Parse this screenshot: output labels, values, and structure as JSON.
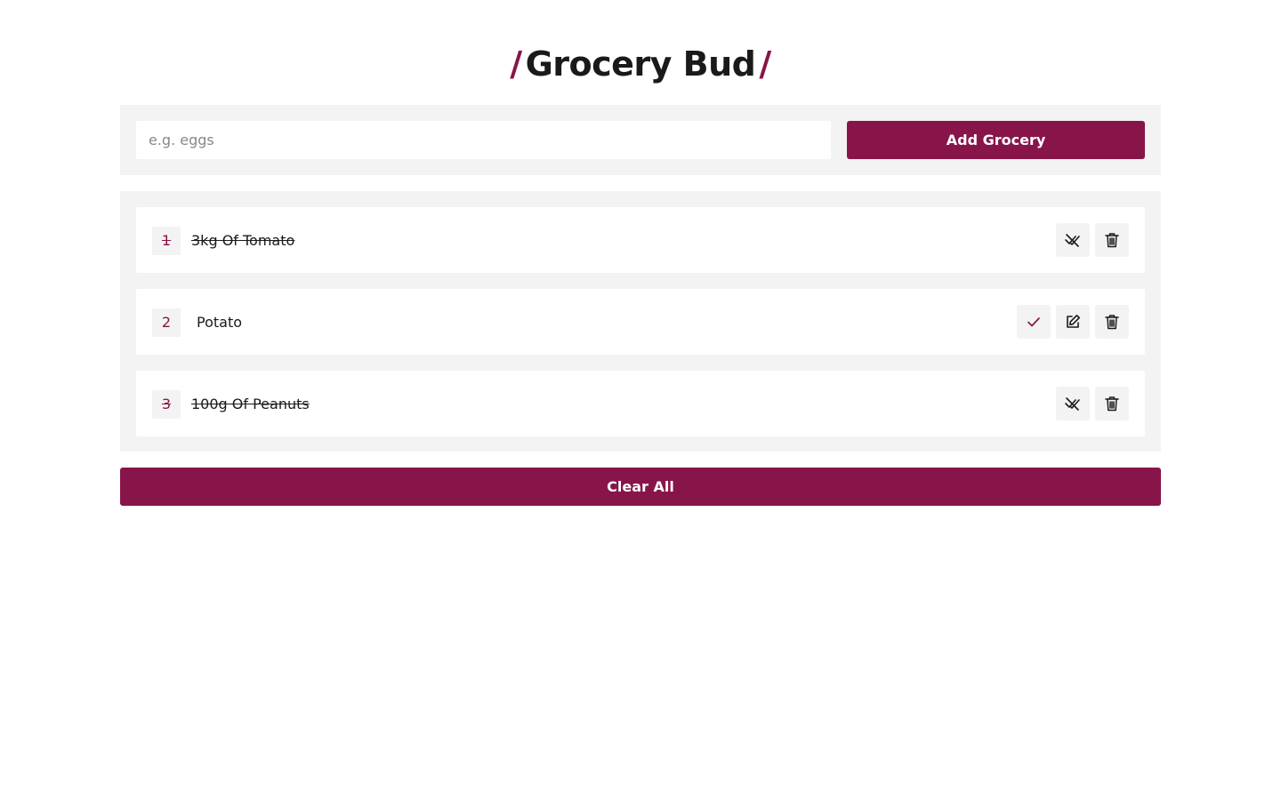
{
  "header": {
    "slash_left": "/",
    "title": "Grocery Bud",
    "slash_right": "/"
  },
  "form": {
    "placeholder": "e.g. eggs",
    "value": "",
    "add_label": "Add Grocery"
  },
  "items": [
    {
      "number": "1",
      "name": "3kg Of Tomato",
      "completed": true,
      "actions": [
        "undo-done-icon",
        "trash-icon"
      ]
    },
    {
      "number": "2",
      "name": "Potato",
      "completed": false,
      "actions": [
        "check-icon",
        "edit-icon",
        "trash-icon"
      ]
    },
    {
      "number": "3",
      "name": "100g Of Peanuts",
      "completed": true,
      "actions": [
        "undo-done-icon",
        "trash-icon"
      ]
    }
  ],
  "clear_label": "Clear All",
  "colors": {
    "accent": "#88154a",
    "panel": "#f3f3f3",
    "text": "#1a1a1a"
  }
}
